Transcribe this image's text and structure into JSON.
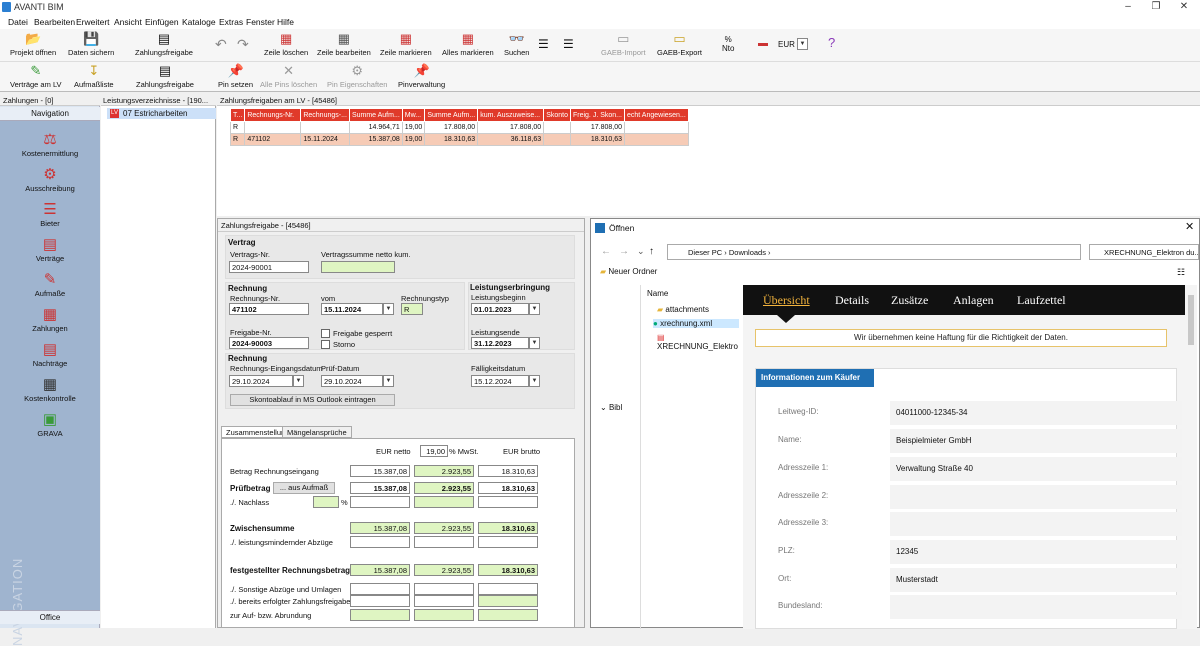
{
  "app": {
    "title": "AVANTI BIM"
  },
  "menu": [
    "Datei",
    "Bearbeiten",
    "Erweitert",
    "Ansicht",
    "Einfügen",
    "Kataloge",
    "Extras",
    "Fenster",
    "Hilfe"
  ],
  "toolbar1": {
    "projekt_oeffnen": "Projekt öffnen",
    "daten_sichern": "Daten sichern",
    "zahlungsfreigabe": "Zahlungsfreigabe",
    "zeile_loeschen": "Zeile löschen",
    "zeile_bearbeiten": "Zeile bearbeiten",
    "zeile_markieren": "Zeile markieren",
    "alles_markieren": "Alles markieren",
    "suchen": "Suchen",
    "gaeb_import": "GAEB-Import",
    "gaeb_export": "GAEB-Export",
    "currency": "EUR"
  },
  "toolbar2": {
    "vertraege_am_lv": "Verträge am LV",
    "aufmassliste": "Aufmaßliste",
    "zahlungsfreigabe": "Zahlungsfreigabe",
    "pin_setzen": "Pin setzen",
    "alle_pins_loeschen": "Alle Pins löschen",
    "pin_eigenschaften": "Pin Eigenschaften",
    "pinverwaltung": "Pinverwaltung"
  },
  "leftnav": {
    "header": "Zahlungen - [0]",
    "title": "Navigation",
    "items": [
      "Kostenermittlung",
      "Ausschreibung",
      "Bieter",
      "Verträge",
      "Aufmaße",
      "Zahlungen",
      "Nachträge",
      "Kostenkontrolle",
      "GRAVA"
    ],
    "vertical": "NAVIGATION",
    "office": "Office"
  },
  "tree": {
    "header": "Leistungsverzeichnisse - [190...",
    "item": "07 Estricharbeiten",
    "item_badge": "LV"
  },
  "grid": {
    "header": "Zahlungsfreigaben am LV - [45486]",
    "columns": [
      "T...",
      "Rechnungs-Nr.",
      "Rechnungs-...",
      "Summe Aufm...",
      "Mw...",
      "Summe Aufm...",
      "kum. Auszuweise...",
      "Skonto",
      "Freig. J. Skon...",
      "echt Angewiesen..."
    ],
    "rows": [
      [
        "R",
        "",
        "",
        "14.964,71",
        "19,00",
        "17.808,00",
        "17.808,00",
        "",
        "17.808,00",
        ""
      ],
      [
        "R",
        "471102",
        "15.11.2024",
        "15.387,08",
        "19,00",
        "18.310,63",
        "36.118,63",
        "",
        "18.310,63",
        ""
      ]
    ]
  },
  "form": {
    "header": "Zahlungsfreigabe - [45486]",
    "vertrag": "Vertrag",
    "vertrags_nr_label": "Vertrags-Nr.",
    "vertrags_nr": "2024-90001",
    "vertragssumme_label": "Vertragssumme netto kum.",
    "rechnung": "Rechnung",
    "rechnungs_nr_label": "Rechnungs-Nr.",
    "rechnungs_nr": "471102",
    "vom_label": "vom",
    "vom": "15.11.2024",
    "rechnungstyp_label": "Rechnungstyp",
    "rechnungstyp": "R",
    "leistungserbringung": "Leistungserbringung",
    "leistungsbeginn_label": "Leistungsbeginn",
    "leistungsbeginn": "01.01.2023",
    "leistungsende_label": "Leistungsende",
    "leistungsende": "31.12.2023",
    "freigabe_nr_label": "Freigabe-Nr.",
    "freigabe_nr": "2024-90003",
    "freigabe_gesperrt": "Freigabe gesperrt",
    "storno": "Storno",
    "rechnung2": "Rechnung",
    "eingangsdatum_label": "Rechnungs-Eingangsdatum",
    "eingangsdatum": "29.10.2024",
    "pruef_label": "Prüf-Datum",
    "pruef": "29.10.2024",
    "faellig_label": "Fälligkeitsdatum",
    "faellig": "15.12.2024",
    "skonto_btn": "Skontoablauf in MS Outlook eintragen",
    "tabs": [
      "Zusammenstellung",
      "Mängelansprüche"
    ],
    "col_netto": "EUR netto",
    "mwst_pct": "19,00",
    "mwst_label": "% MwSt.",
    "col_brutto": "EUR brutto",
    "betrag_label": "Betrag Rechnungseingang",
    "betrag": [
      "15.387,08",
      "2.923,55",
      "18.310,63"
    ],
    "pruefbetrag_label": "Prüfbetrag",
    "aus_aufmass": "... aus Aufmaß",
    "pruefbetrag": [
      "15.387,08",
      "2.923,55",
      "18.310,63"
    ],
    "nachlass_label": "./. Nachlass",
    "pct": "%",
    "zwischen_label": "Zwischensumme",
    "zwischen": [
      "15.387,08",
      "2.923,55",
      "18.310,63"
    ],
    "leistungsmindernd_label": "./. leistungsmindernder Abzüge",
    "festgestellt_label": "festgestellter Rechnungsbetrag",
    "festgestellt": [
      "15.387,08",
      "2.923,55",
      "18.310,63"
    ],
    "sonstige_label": "./. Sonstige Abzüge und Umlagen",
    "bereits_label": "./. bereits erfolgter Zahlungsfreigaben",
    "abrundung_label": "zur Auf- bzw. Abrundung"
  },
  "dialog": {
    "title": "Öffnen",
    "path": [
      "Dieser PC",
      "Downloads"
    ],
    "search": "XRECHNUNG_Elektron du...",
    "new_folder": "Neuer Ordner",
    "name_col": "Name",
    "files": [
      "attachments",
      "xrechnung.xml",
      "XRECHNUNG_Elektro"
    ],
    "nav_bib": "Bibl",
    "viewer_tabs": [
      "Übersicht",
      "Details",
      "Zusätze",
      "Anlagen",
      "Laufzettel"
    ],
    "notice": "Wir übernehmen keine Haftung für die Richtigkeit der Daten.",
    "info_title": "Informationen zum Käufer",
    "info": [
      [
        "Leitweg-ID:",
        "04011000-12345-34"
      ],
      [
        "Name:",
        "Beispielmieter GmbH"
      ],
      [
        "Adresszeile 1:",
        "Verwaltung Straße 40"
      ],
      [
        "Adresszeile 2:",
        ""
      ],
      [
        "Adresszeile 3:",
        ""
      ],
      [
        "PLZ:",
        "12345"
      ],
      [
        "Ort:",
        "Musterstadt"
      ],
      [
        "Bundesland:",
        ""
      ]
    ]
  },
  "colors": {
    "accent": "#e03a2a",
    "nav": "#9fb4cf",
    "green": "#dff5c2",
    "blue": "#1f6fb3"
  }
}
